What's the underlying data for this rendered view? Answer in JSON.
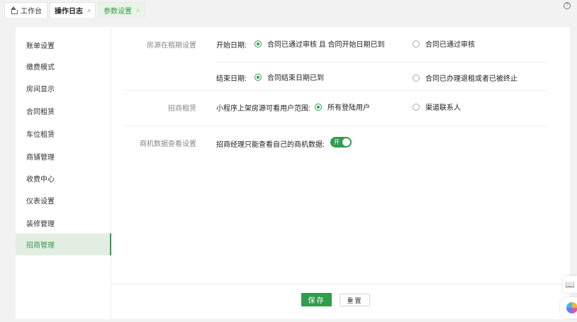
{
  "tabs": [
    {
      "label": "工作台",
      "icon": "home-icon"
    },
    {
      "label": "操作日志",
      "close": "×"
    },
    {
      "label": "参数设置",
      "close": "×"
    }
  ],
  "help_icon": "?",
  "sidebar": {
    "items": [
      {
        "label": "账单设置"
      },
      {
        "label": "缴费模式"
      },
      {
        "label": "房间显示"
      },
      {
        "label": "合同租赁"
      },
      {
        "label": "车位租赁"
      },
      {
        "label": "商铺管理"
      },
      {
        "label": "收费中心"
      },
      {
        "label": "仪表设置"
      },
      {
        "label": "装修管理"
      },
      {
        "label": "招商管理",
        "active": true
      }
    ]
  },
  "sections": {
    "rent_period": {
      "label": "房源在租期设置",
      "start": {
        "label": "开始日期:",
        "option1": "合同已通过审核 且 合同开始日期已到",
        "option2": "合同已通过审核",
        "selected": 1
      },
      "end": {
        "label": "结束日期:",
        "option1": "合同结束日期已到",
        "option2": "合同已办理退租或者已被终止",
        "selected": 1
      }
    },
    "leasing": {
      "label": "招商租赁",
      "scope": {
        "label": "小程序上架房源可看用户范围:",
        "option1": "所有登陆用户",
        "option2": "渠道联系人",
        "selected": 1
      }
    },
    "biz_data": {
      "label": "商机数据查看设置",
      "manager": {
        "label": "招商经理只能查看自己的商机数据:",
        "toggle_text": "开",
        "on": true
      }
    }
  },
  "footer": {
    "save_label": "保存",
    "reset_label": "重置"
  },
  "colors": {
    "accent": "#2e9e4c",
    "active_bg": "#e3eee2"
  }
}
